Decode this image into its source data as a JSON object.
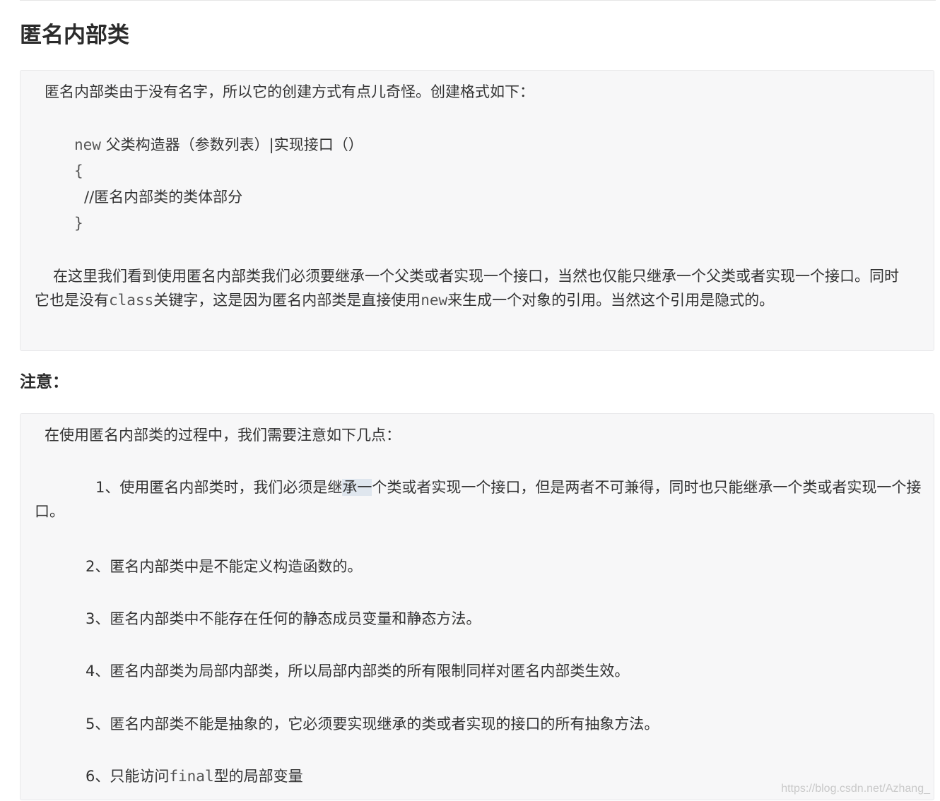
{
  "section_title": "匿名内部类",
  "box1": {
    "intro": "匿名内部类由于没有名字，所以它的创建方式有点儿奇怪。创建格式如下：",
    "code": {
      "line1_kw": "new",
      "line1_rest": "父类构造器（参数列表）|实现接口（）",
      "line2": "{",
      "line3": "//匿名内部类的类体部分",
      "line4": "}"
    },
    "para_part1": "在这里我们看到使用匿名内部类我们必须要继承一个父类或者实现一个接口，当然也仅能只继承一个父类或者实现一个接口。同时它也是没有",
    "para_class": "class",
    "para_part2": "关键字，这是因为匿名内部类是直接使用",
    "para_new": "new",
    "para_part3": "来生成一个对象的引用。当然这个引用是隐式的。"
  },
  "note_title": "注意：",
  "box2": {
    "intro": "在使用匿名内部类的过程中，我们需要注意如下几点：",
    "item1_a": "1、使用匿名内部类时，我们必须是继",
    "item1_sel": "承一",
    "item1_b": "个类或者实现一个接口，但是两者不可兼得，同时也只能继承一个类或者实现一个接口。",
    "item2": "2、匿名内部类中是不能定义构造函数的。",
    "item3": "3、匿名内部类中不能存在任何的静态成员变量和静态方法。",
    "item4": "4、匿名内部类为局部内部类，所以局部内部类的所有限制同样对匿名内部类生效。",
    "item5": "5、匿名内部类不能是抽象的，它必须要实现继承的类或者实现的接口的所有抽象方法。",
    "item6_a": "6、只能访问",
    "item6_code": "final",
    "item6_b": "型的局部变量"
  },
  "watermark": "https://blog.csdn.net/Azhang_"
}
